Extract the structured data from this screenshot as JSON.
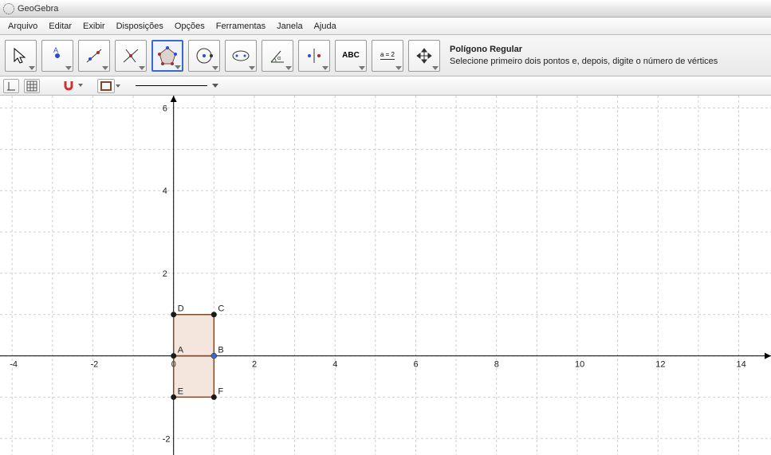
{
  "app": {
    "title": "GeoGebra"
  },
  "menu": {
    "items": [
      "Arquivo",
      "Editar",
      "Exibir",
      "Disposições",
      "Opções",
      "Ferramentas",
      "Janela",
      "Ajuda"
    ]
  },
  "toolbar": {
    "tools": [
      {
        "name": "move",
        "label": "Mover"
      },
      {
        "name": "point",
        "label": "Ponto"
      },
      {
        "name": "line",
        "label": "Reta"
      },
      {
        "name": "perpendicular",
        "label": "Perpendicular"
      },
      {
        "name": "polygon",
        "label": "Polígono Regular",
        "selected": true
      },
      {
        "name": "circle",
        "label": "Círculo"
      },
      {
        "name": "ellipse",
        "label": "Elipse"
      },
      {
        "name": "angle",
        "label": "Ângulo"
      },
      {
        "name": "reflect",
        "label": "Reflexão"
      },
      {
        "name": "text",
        "label": "Texto",
        "text": "ABC"
      },
      {
        "name": "slider",
        "label": "Controle Deslizante",
        "text": "a = 2"
      },
      {
        "name": "move-view",
        "label": "Mover Janela"
      }
    ],
    "hint": {
      "title": "Polígono Regular",
      "desc": "Selecione primeiro dois pontos e, depois, digite o número de vértices"
    }
  },
  "secondary": {
    "axes_btn": "axes",
    "grid_btn": "grid",
    "magnet_btn": "magnet",
    "color_btn": "color",
    "line_btn": "line-style"
  },
  "chart_data": {
    "type": "scatter",
    "title": "",
    "xlabel": "",
    "ylabel": "",
    "xlim": [
      -4.3,
      14.8
    ],
    "ylim": [
      -2.4,
      6.3
    ],
    "grid": true,
    "x_ticks": [
      -4,
      -2,
      0,
      2,
      4,
      6,
      8,
      10,
      12,
      14
    ],
    "y_ticks": [
      -2,
      0,
      2,
      4,
      6
    ],
    "points": [
      {
        "label": "A",
        "x": 0,
        "y": 0
      },
      {
        "label": "B",
        "x": 1,
        "y": 0,
        "color": "blue"
      },
      {
        "label": "C",
        "x": 1,
        "y": 1
      },
      {
        "label": "D",
        "x": 0,
        "y": 1
      },
      {
        "label": "E",
        "x": 0,
        "y": -1
      },
      {
        "label": "F",
        "x": 1,
        "y": -1
      }
    ],
    "polygons": [
      {
        "vertices": [
          "A",
          "B",
          "C",
          "D"
        ]
      },
      {
        "vertices": [
          "A",
          "B",
          "F",
          "E"
        ]
      }
    ]
  }
}
